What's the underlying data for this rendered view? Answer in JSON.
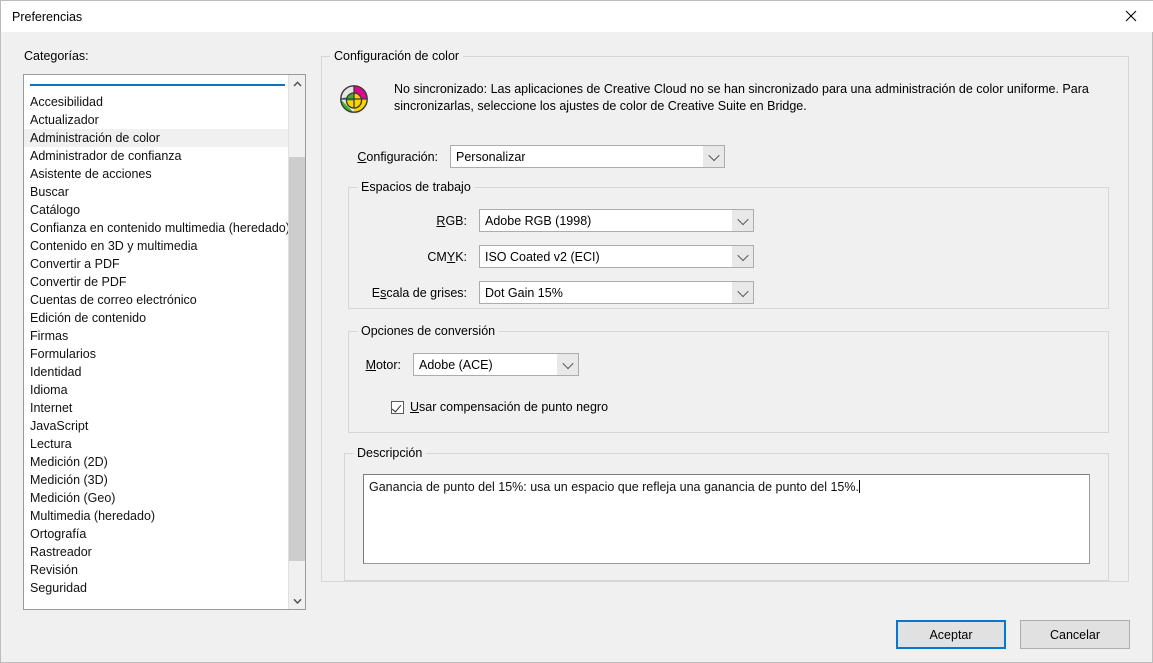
{
  "window": {
    "title": "Preferencias",
    "close_icon": "close-icon"
  },
  "sidebar": {
    "label": "Categorías:",
    "selected": "Administración de color",
    "items": [
      "Accesibilidad",
      "Actualizador",
      "Administración de color",
      "Administrador de confianza",
      "Asistente de acciones",
      "Buscar",
      "Catálogo",
      "Confianza en contenido multimedia (heredado)",
      "Contenido en 3D y multimedia",
      "Convertir a PDF",
      "Convertir de PDF",
      "Cuentas de correo electrónico",
      "Edición de contenido",
      "Firmas",
      "Formularios",
      "Identidad",
      "Idioma",
      "Internet",
      "JavaScript",
      "Lectura",
      "Medición (2D)",
      "Medición (3D)",
      "Medición (Geo)",
      "Multimedia (heredado)",
      "Ortografía",
      "Rastreador",
      "Revisión",
      "Seguridad"
    ],
    "scroll_up_icon": "chevron-up-icon",
    "scroll_down_icon": "chevron-down-icon"
  },
  "panel": {
    "title": "Configuración de color",
    "sync": {
      "icon": "color-wheel-icon",
      "message": "No sincronizado: Las aplicaciones de Creative Cloud no se han sincronizado para una administración de color uniforme. Para sincronizarlas, seleccione los ajustes de color de Creative Suite en Bridge."
    },
    "settings": {
      "label_prefix": "C",
      "label_rest": "onfiguración:",
      "value": "Personalizar",
      "arrow_icon": "chevron-down-icon"
    },
    "workspaces": {
      "title": "Espacios de trabajo",
      "rows": [
        {
          "label_pre": "",
          "label_key": "R",
          "label_post": "GB:",
          "value": "Adobe RGB (1998)"
        },
        {
          "label_pre": "CM",
          "label_key": "Y",
          "label_post": "K:",
          "value": "ISO Coated v2 (ECI)"
        },
        {
          "label_pre": "E",
          "label_key": "s",
          "label_post": "cala de grises:",
          "value": "Dot Gain 15%"
        }
      ],
      "arrow_icon": "chevron-down-icon"
    },
    "conversion": {
      "title": "Opciones de conversión",
      "engine": {
        "label_key": "M",
        "label_post": "otor:",
        "value": "Adobe (ACE)",
        "arrow_icon": "chevron-down-icon"
      },
      "blackpoint": {
        "checked": true,
        "label_key": "U",
        "label_post": "sar compensación de punto negro"
      }
    },
    "description": {
      "title": "Descripción",
      "text": "Ganancia de punto del 15%: usa un espacio que refleja una ganancia de punto del 15%."
    }
  },
  "footer": {
    "ok_label": "Aceptar",
    "cancel_label": "Cancelar"
  },
  "colors": {
    "accent": "#0078d7",
    "rule": "#0a73c6",
    "window_bg": "#f0f0f0",
    "selection": "#f0f0f0",
    "wheel_blue": "#3a9ad9",
    "wheel_magenta": "#e0058f",
    "wheel_green": "#3eb22a",
    "wheel_yellow": "#ffd200"
  }
}
